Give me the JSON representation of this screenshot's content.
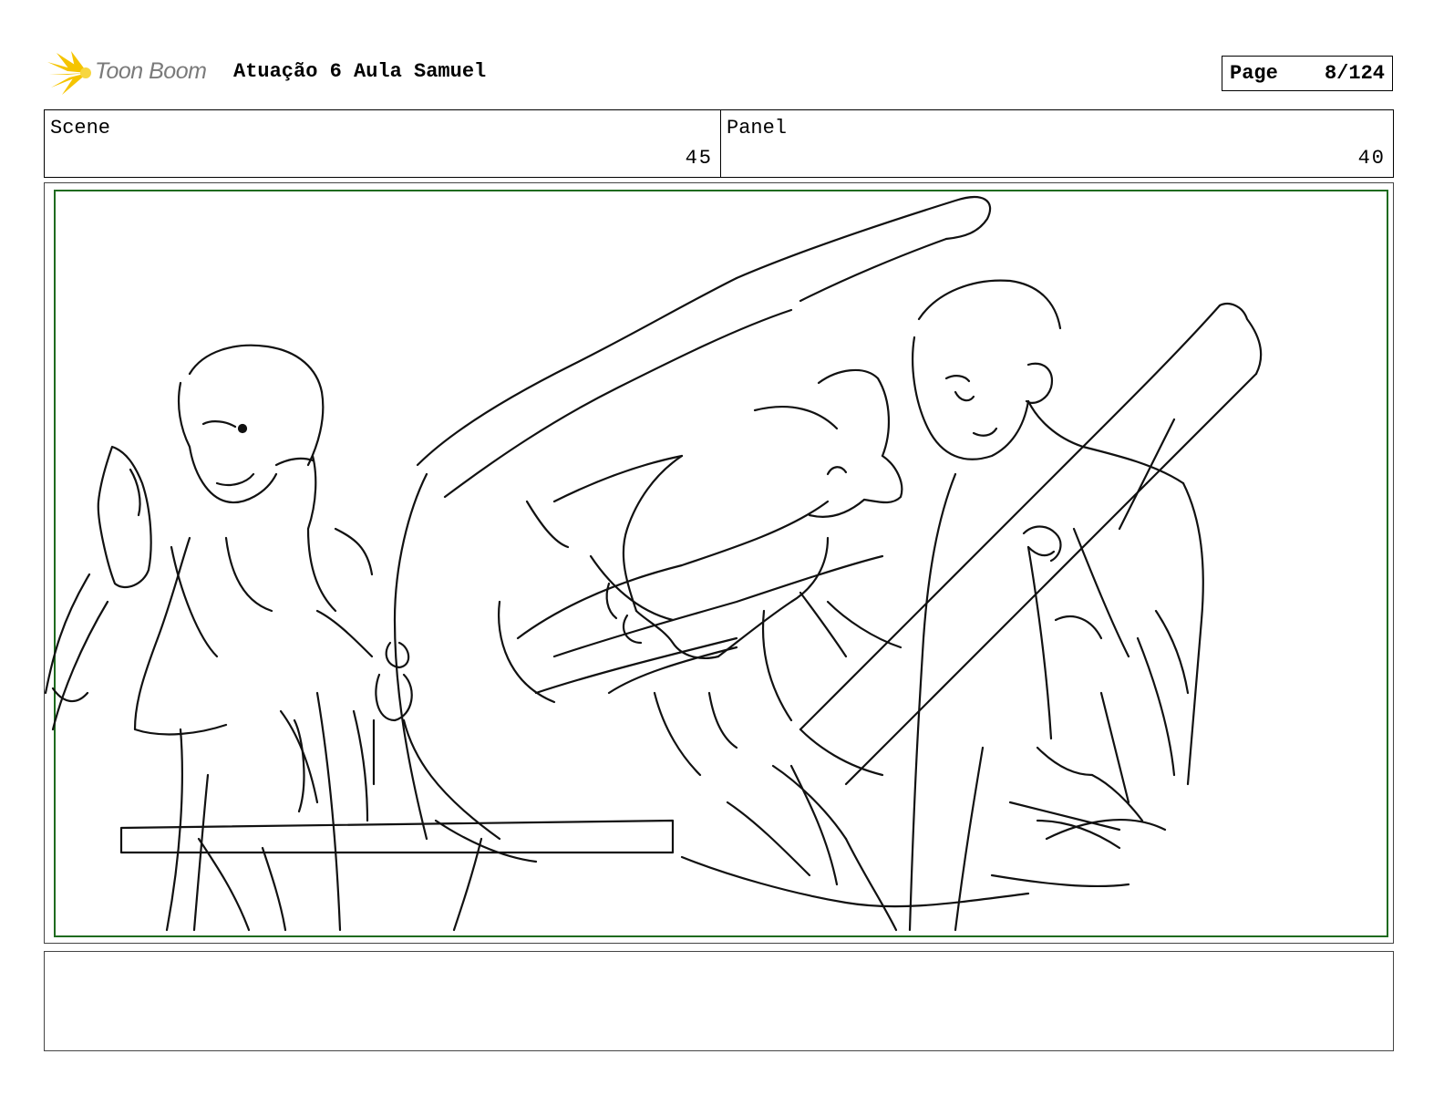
{
  "header": {
    "logo_text": "Toon Boom",
    "project_title": "Atuação 6 Aula Samuel",
    "page_label": "Page",
    "page_value": "8/124"
  },
  "info": {
    "scene_label": "Scene",
    "scene_value": "45",
    "panel_label": "Panel",
    "panel_value": "40"
  },
  "notes": {
    "text": ""
  },
  "colors": {
    "safe_frame": "#1f6b1f",
    "logo_burst": "#f5c400"
  }
}
